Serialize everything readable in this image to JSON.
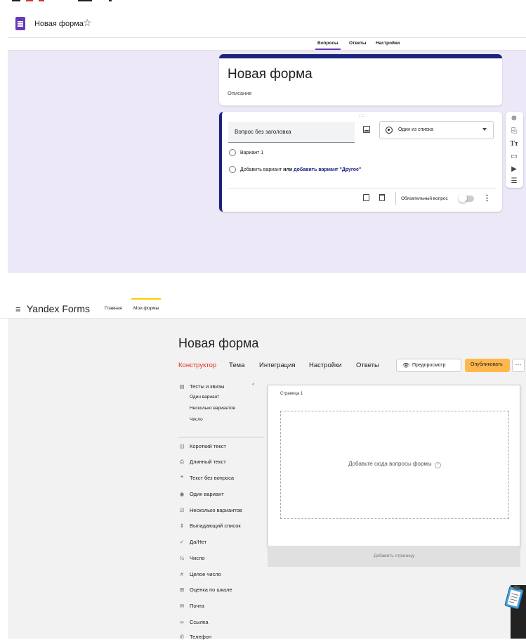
{
  "gforms": {
    "form_name": "Новая форма",
    "tabs": [
      "Вопросы",
      "Ответы",
      "Настройки"
    ],
    "title": "Новая форма",
    "description": "Описание",
    "question": {
      "placeholder": "Вопрос без заголовка",
      "type": "Один из списка",
      "option1": "Вариант 1",
      "add_option": "Добавить вариант",
      "or": "или",
      "add_other": "добавить вариант \"Другое\"",
      "required": "Обязательный вопрос"
    },
    "icons": [
      "star-icon",
      "add-question-icon",
      "import-questions-icon",
      "add-title-icon",
      "add-image-icon",
      "add-video-icon",
      "add-section-icon",
      "copy-icon",
      "delete-icon",
      "more-icon"
    ],
    "colors": {
      "accent": "#673ab7",
      "card_border": "#1a237e",
      "background": "#ece8f7"
    }
  },
  "yforms": {
    "brand": "Yandex Forms",
    "nav": [
      "Главная",
      "Мои формы"
    ],
    "title": "Новая форма",
    "tabs": [
      "Конструктор",
      "Тема",
      "Интеграция",
      "Настройки",
      "Ответы"
    ],
    "preview": "Предпросмотр",
    "publish": "Опубликовать",
    "more": "···",
    "group": "Тесты и квизы",
    "group_items": [
      "Один вариант",
      "Несколько вариантов",
      "Число"
    ],
    "blocks": [
      "Короткий текст",
      "Длинный текст",
      "Текст без вопроса",
      "Один вариант",
      "Несколько вариантов",
      "Выпадающий список",
      "Да/Нет",
      "Число",
      "Целое число",
      "Оценка по шкале",
      "Почта",
      "Ссылка",
      "Телефон"
    ],
    "page_title": "Страница 1",
    "drop_hint": "Добавьте сюда вопросы формы",
    "add_page": "Добавить страницу",
    "colors": {
      "active_tab": "#e52d1a",
      "publish": "#ffb84d",
      "nav_underline": "#ffcc00"
    }
  }
}
